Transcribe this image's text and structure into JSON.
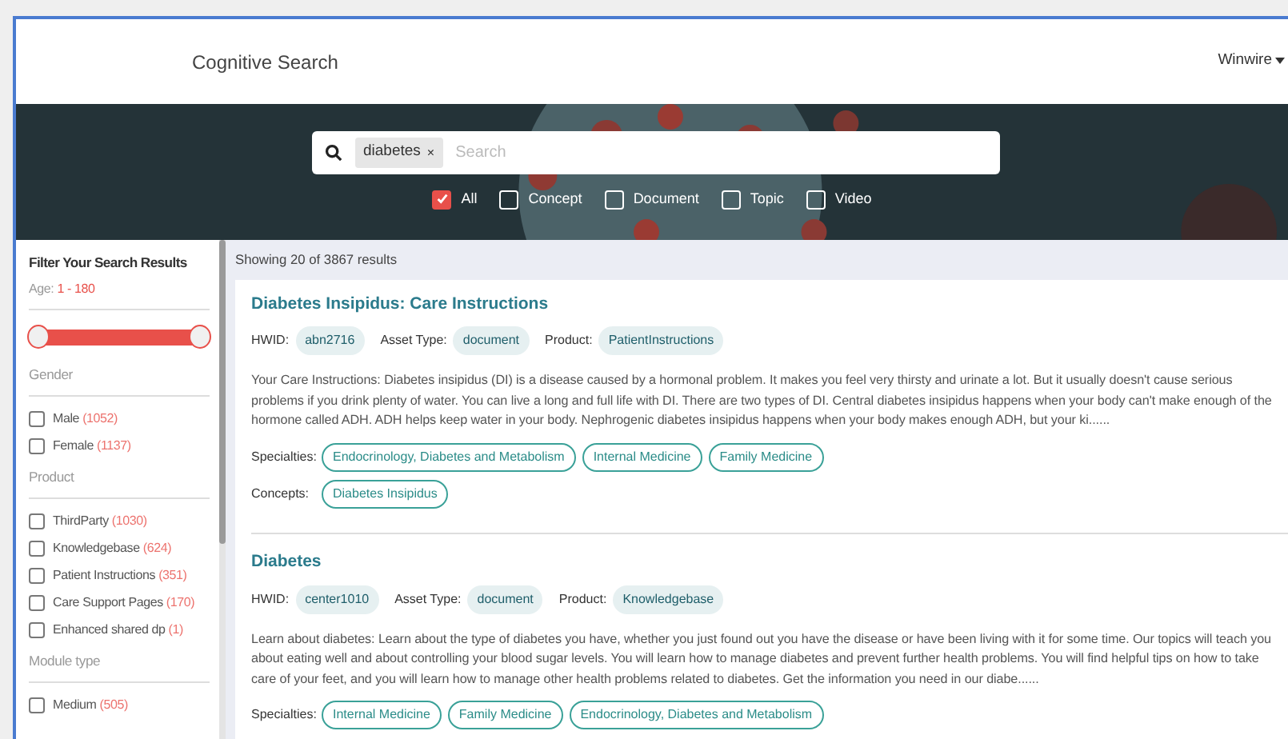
{
  "navbar": {
    "brand": "Cognitive Search",
    "user": "Winwire"
  },
  "search": {
    "chips": [
      {
        "label": "diabetes",
        "remove": "×"
      }
    ],
    "placeholder": "Search"
  },
  "filters": [
    {
      "label": "All",
      "checked": true
    },
    {
      "label": "Concept",
      "checked": false
    },
    {
      "label": "Document",
      "checked": false
    },
    {
      "label": "Topic",
      "checked": false
    },
    {
      "label": "Video",
      "checked": false
    }
  ],
  "sidebar": {
    "title": "Filter Your Search Results",
    "age": {
      "label": "Age:",
      "range": "1 - 180",
      "low": {
        "level": 0
      },
      "high": {
        "level": 1
      }
    },
    "groups": [
      {
        "title": "Gender",
        "options": [
          {
            "label": "Male",
            "count": "(1052)",
            "checked": false
          },
          {
            "label": "Female",
            "count": "(1137)",
            "checked": false
          }
        ]
      },
      {
        "title": "Product",
        "options": [
          {
            "label": "ThirdParty",
            "count": "(1030)",
            "checked": false
          },
          {
            "label": "Knowledgebase",
            "count": "(624)",
            "checked": false
          },
          {
            "label": "Patient Instructions",
            "count": "(351)",
            "checked": false
          },
          {
            "label": "Care Support Pages",
            "count": "(170)",
            "checked": false
          },
          {
            "label": "Enhanced shared dp",
            "count": "(1)",
            "checked": false
          }
        ]
      },
      {
        "title": "Module type",
        "options": [
          {
            "label": "Medium",
            "count": "(505)",
            "checked": false
          }
        ]
      }
    ]
  },
  "results": {
    "summary": "Showing 20 of 3867 results",
    "items": [
      {
        "title": "Diabetes Insipidus: Care Instructions",
        "fields": [
          {
            "label": "HWID:",
            "value": "abn2716"
          },
          {
            "label": "Asset Type:",
            "value": "document"
          },
          {
            "label": "Product:",
            "value": "PatientInstructions"
          }
        ],
        "text": "Your Care Instructions: Diabetes insipidus (DI) is a disease caused by a hormonal problem. It makes you feel very thirsty and urinate a lot. But it usually doesn't cause serious problems if you drink plenty of water. You can live a long and full life with DI. There are two types of DI. Central diabetes insipidus happens when your body can't make enough of the hormone called ADH. ADH helps keep water in your body. Nephrogenic diabetes insipidus happens when your body makes enough ADH, but your ki......",
        "tag_rows": [
          {
            "label": "Specialties:",
            "tags": [
              "Endocrinology, Diabetes and Metabolism",
              "Internal Medicine",
              "Family Medicine"
            ]
          },
          {
            "label": "Concepts:",
            "tags": [
              "Diabetes Insipidus"
            ]
          }
        ]
      },
      {
        "title": "Diabetes",
        "fields": [
          {
            "label": "HWID:",
            "value": "center1010"
          },
          {
            "label": "Asset Type:",
            "value": "document"
          },
          {
            "label": "Product:",
            "value": "Knowledgebase"
          }
        ],
        "text": "Learn about diabetes: Learn about the type of diabetes you have, whether you just found out you have the disease or have been living with it for some time. Our topics will teach you about eating well and about controlling your blood sugar levels. You will learn how to manage diabetes and prevent further health problems. You will find helpful tips on how to take care of your feet, and you will learn how to manage other health problems related to diabetes. Get the information you need in our diabe......",
        "tag_rows": [
          {
            "label": "Specialties:",
            "tags": [
              "Internal Medicine",
              "Family Medicine",
              "Endocrinology, Diabetes and Metabolism"
            ]
          }
        ]
      }
    ]
  }
}
